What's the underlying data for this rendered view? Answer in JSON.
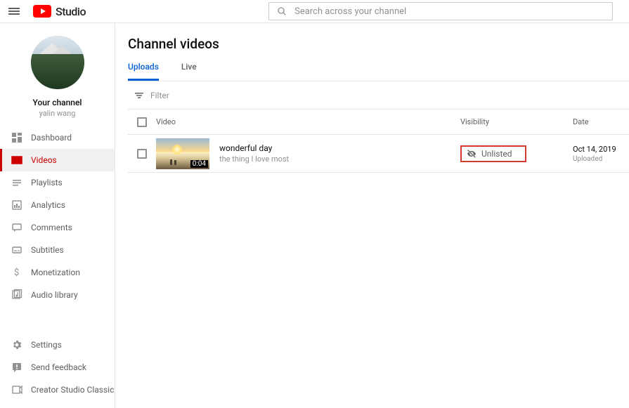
{
  "header": {
    "logo_text": "Studio",
    "search_placeholder": "Search across your channel"
  },
  "channel": {
    "label": "Your channel",
    "name": "yalin wang"
  },
  "sidebar": {
    "items": [
      {
        "label": "Dashboard"
      },
      {
        "label": "Videos"
      },
      {
        "label": "Playlists"
      },
      {
        "label": "Analytics"
      },
      {
        "label": "Comments"
      },
      {
        "label": "Subtitles"
      },
      {
        "label": "Monetization"
      },
      {
        "label": "Audio library"
      }
    ],
    "bottom": [
      {
        "label": "Settings"
      },
      {
        "label": "Send feedback"
      },
      {
        "label": "Creator Studio Classic"
      }
    ]
  },
  "page": {
    "title": "Channel videos",
    "tabs": [
      {
        "label": "Uploads"
      },
      {
        "label": "Live"
      }
    ],
    "filter_placeholder": "Filter",
    "columns": {
      "video": "Video",
      "visibility": "Visibility",
      "date": "Date"
    },
    "video": {
      "title": "wonderful day",
      "subtitle": "the thing I love most",
      "duration": "0:04",
      "visibility": "Unlisted",
      "date": "Oct 14, 2019",
      "date_sub": "Uploaded"
    }
  }
}
